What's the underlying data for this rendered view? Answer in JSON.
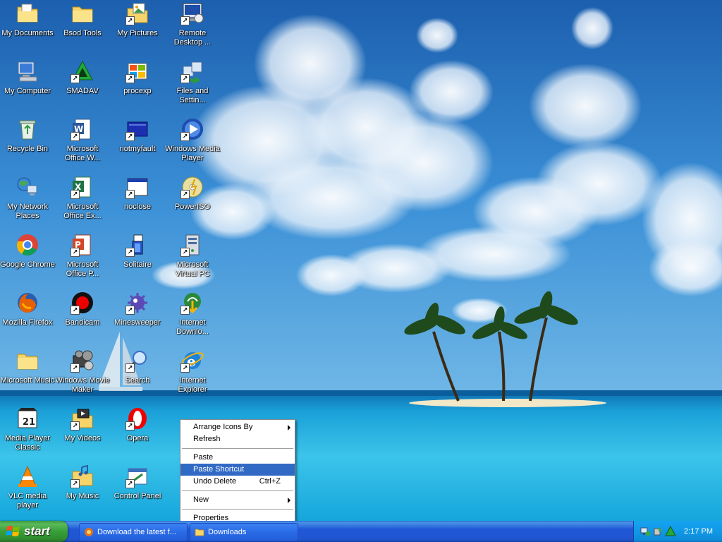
{
  "desktop": {
    "icons": [
      {
        "label": "My Documents",
        "icon": "folder-docs-icon",
        "shortcut": false
      },
      {
        "label": "My Computer",
        "icon": "computer-icon",
        "shortcut": false
      },
      {
        "label": "Recycle Bin",
        "icon": "recycle-bin-icon",
        "shortcut": false
      },
      {
        "label": "My Network\nPlaces",
        "icon": "network-places-icon",
        "shortcut": false
      },
      {
        "label": "Google Chrome",
        "icon": "chrome-icon",
        "shortcut": false
      },
      {
        "label": "Mozilla Firefox",
        "icon": "firefox-icon",
        "shortcut": false
      },
      {
        "label": "Microsoft Music",
        "icon": "folder-icon",
        "shortcut": false
      },
      {
        "label": "Media Player\nClassic",
        "icon": "mpc-icon",
        "shortcut": false
      },
      {
        "label": "VLC media\nplayer",
        "icon": "vlc-icon",
        "shortcut": false
      },
      {
        "label": "Bsod Tools",
        "icon": "folder-icon",
        "shortcut": false
      },
      {
        "label": "SMADAV",
        "icon": "smadav-icon",
        "shortcut": true
      },
      {
        "label": "Microsoft\nOffice W...",
        "icon": "word-icon",
        "shortcut": true
      },
      {
        "label": "Microsoft\nOffice Ex...",
        "icon": "excel-icon",
        "shortcut": true
      },
      {
        "label": "Microsoft\nOffice P...",
        "icon": "powerpoint-icon",
        "shortcut": true
      },
      {
        "label": "Bandicam",
        "icon": "bandicam-icon",
        "shortcut": true
      },
      {
        "label": "Windows Movie\nMaker",
        "icon": "movie-maker-icon",
        "shortcut": true
      },
      {
        "label": "My Videos",
        "icon": "folder-videos-icon",
        "shortcut": true
      },
      {
        "label": "My Music",
        "icon": "folder-music-icon",
        "shortcut": true
      },
      {
        "label": "My Pictures",
        "icon": "folder-pictures-icon",
        "shortcut": true
      },
      {
        "label": "procexp",
        "icon": "procexp-icon",
        "shortcut": true
      },
      {
        "label": "notmyfault",
        "icon": "notmyfault-icon",
        "shortcut": true
      },
      {
        "label": "noclose",
        "icon": "app-window-icon",
        "shortcut": true
      },
      {
        "label": "Solitaire",
        "icon": "solitaire-icon",
        "shortcut": true
      },
      {
        "label": "Minesweeper",
        "icon": "minesweeper-icon",
        "shortcut": true
      },
      {
        "label": "Search",
        "icon": "search-icon",
        "shortcut": true
      },
      {
        "label": "Opera",
        "icon": "opera-icon",
        "shortcut": true
      },
      {
        "label": "Control Panel",
        "icon": "control-panel-icon",
        "shortcut": true
      },
      {
        "label": "Remote\nDesktop ...",
        "icon": "remote-desktop-icon",
        "shortcut": true
      },
      {
        "label": "Files and\nSettin...",
        "icon": "files-settings-icon",
        "shortcut": true
      },
      {
        "label": "Windows Media\nPlayer",
        "icon": "media-player-icon",
        "shortcut": true
      },
      {
        "label": "PowerISO",
        "icon": "poweriso-icon",
        "shortcut": true
      },
      {
        "label": "Microsoft\nVirtual PC",
        "icon": "virtual-pc-icon",
        "shortcut": true
      },
      {
        "label": "Internet\nDownlo...",
        "icon": "idm-icon",
        "shortcut": true
      },
      {
        "label": "Internet\nExplorer",
        "icon": "ie-icon",
        "shortcut": true
      }
    ]
  },
  "context_menu": {
    "items": [
      {
        "label": "Arrange Icons By",
        "submenu": true
      },
      {
        "label": "Refresh"
      },
      {
        "separator": true
      },
      {
        "label": "Paste"
      },
      {
        "label": "Paste Shortcut",
        "highlighted": true
      },
      {
        "label": "Undo Delete",
        "accel": "Ctrl+Z"
      },
      {
        "separator": true
      },
      {
        "label": "New",
        "submenu": true
      },
      {
        "separator": true
      },
      {
        "label": "Properties"
      }
    ]
  },
  "taskbar": {
    "start_label": "start",
    "tasks": [
      {
        "label": "Download the latest f...",
        "icon": "browser-task-icon"
      },
      {
        "label": "Downloads",
        "icon": "folder-icon"
      }
    ],
    "tray_icons": [
      "network-icon",
      "safely-remove-icon",
      "smadav-tray-icon"
    ],
    "clock": "2:17 PM"
  },
  "colors": {
    "menu_highlight": "#316ac5",
    "taskbar_blue": "#2157d7",
    "start_green": "#37a037",
    "tray_blue": "#119be9"
  }
}
